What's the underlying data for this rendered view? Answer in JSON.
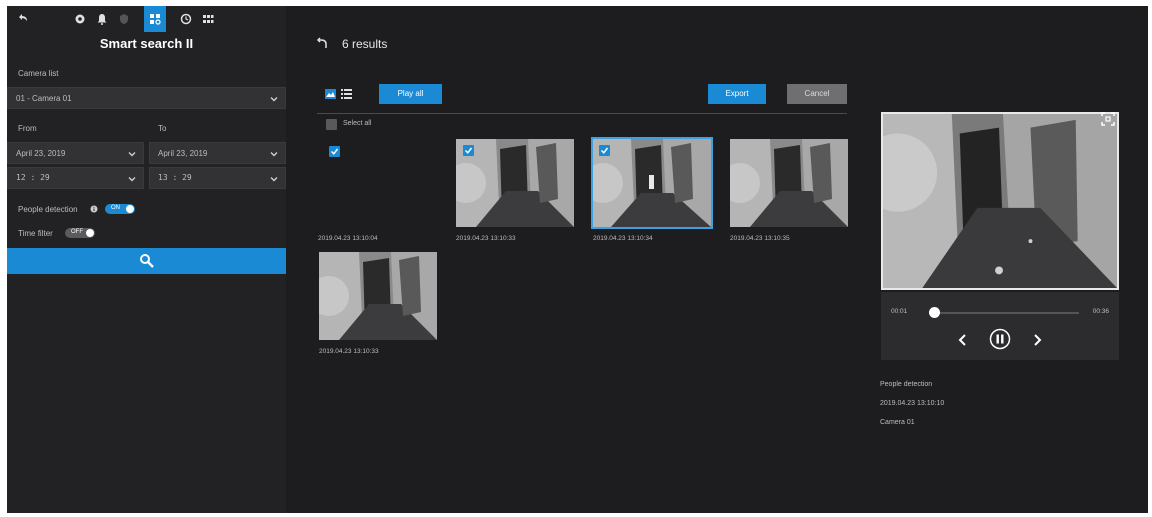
{
  "sidebar": {
    "toolbar_icons": [
      "back-icon",
      "camera-icon",
      "bell-icon",
      "shield-icon",
      "smart-search-icon",
      "playback-icon",
      "grid-icon"
    ],
    "title": "Smart search II",
    "camera_list_label": "Camera list",
    "camera_value": "01 - Camera 01",
    "from_label": "From",
    "to_label": "To",
    "from_date": "April 23, 2019",
    "to_date": "April 23, 2019",
    "from_time": "12 : 29",
    "to_time": "13 : 29",
    "people_detection_label": "People detection",
    "people_detection_toggle": "ON",
    "time_filter_label": "Time filter",
    "time_filter_toggle": "OFF",
    "search_icon": "search-icon"
  },
  "main": {
    "results_text": "6 results",
    "play_all_label": "Play all",
    "export_label": "Export",
    "cancel_label": "Cancel",
    "select_all_label": "Select all",
    "thumbnails": [
      {
        "timestamp": "2019.04.23 13:10:04",
        "checked": true,
        "has_image": false,
        "selected": false
      },
      {
        "timestamp": "2019.04.23 13:10:33",
        "checked": true,
        "has_image": true,
        "selected": false
      },
      {
        "timestamp": "2019.04.23 13:10:34",
        "checked": true,
        "has_image": true,
        "selected": true
      },
      {
        "timestamp": "2019.04.23 13:10:35",
        "checked": false,
        "has_image": true,
        "selected": false
      },
      {
        "timestamp": "2019.04.23 13:10:33",
        "checked": false,
        "has_image": true,
        "selected": false
      }
    ]
  },
  "player": {
    "current_time": "00:01",
    "total_time": "00:36",
    "progress": 0.03
  },
  "details": {
    "event_type": "People detection",
    "timestamp": "2019.04.23 13:10:10",
    "camera": "Camera 01"
  },
  "colors": {
    "accent": "#1a8ad4",
    "background": "#1d1d1f",
    "sidebar": "#222224"
  }
}
